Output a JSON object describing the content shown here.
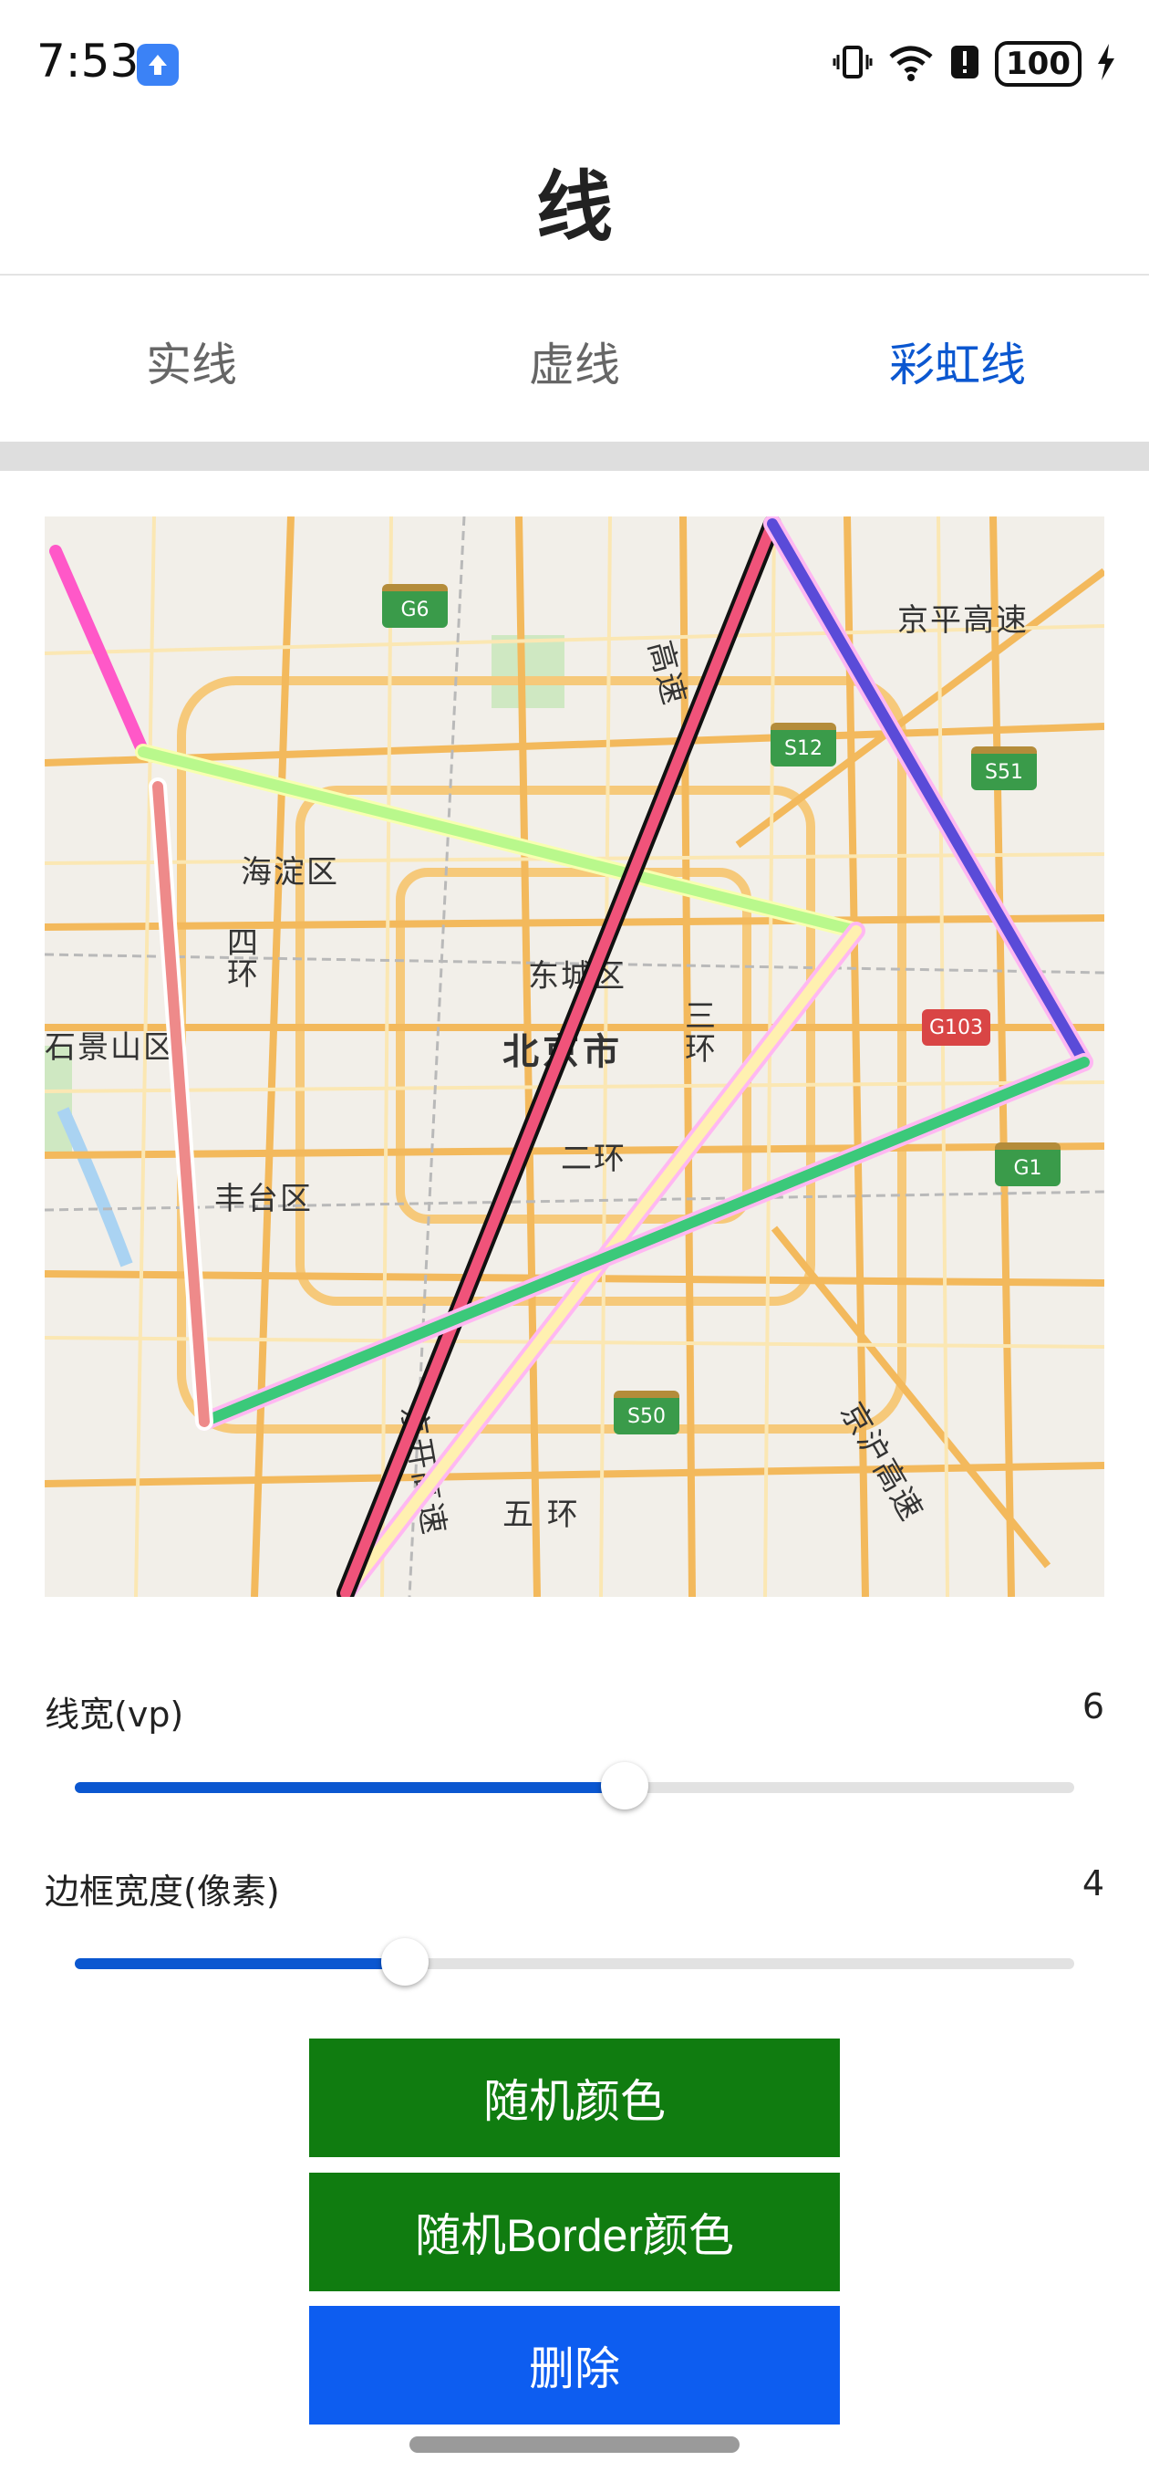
{
  "status_bar": {
    "time": "7:53",
    "battery": "100"
  },
  "page": {
    "title": "线"
  },
  "tabs": [
    {
      "label": "实线",
      "active": false
    },
    {
      "label": "虚线",
      "active": false
    },
    {
      "label": "彩虹线",
      "active": true
    }
  ],
  "map": {
    "labels": {
      "haidian": "海淀区",
      "dongcheng": "东城区",
      "beijing": "北京市",
      "shijingshan": "石景山区",
      "fengtai": "丰台区",
      "ring2": "二环",
      "ring3_a": "三",
      "ring3_b": "环",
      "ring4_a": "四",
      "ring4_b": "环",
      "ring5": "五 环",
      "jingping": "京平高速",
      "jinghu": "京沪高速",
      "jingcheng": "高速",
      "jingkai": "京开高速"
    },
    "shields": {
      "g6": "G6",
      "s12": "S12",
      "s51": "S51",
      "g103": "G103",
      "g1": "G1",
      "s50": "S50"
    }
  },
  "controls": {
    "line_width": {
      "label": "线宽(vp)",
      "value": "6",
      "fraction": 0.55
    },
    "border_width": {
      "label": "边框宽度(像素)",
      "value": "4",
      "fraction": 0.33
    }
  },
  "buttons": {
    "random_color": "随机颜色",
    "random_border_color": "随机Border颜色",
    "delete": "删除"
  },
  "colors": {
    "accent": "#0b57d0",
    "green_button": "#107c10",
    "blue_button": "#0d5df0"
  }
}
